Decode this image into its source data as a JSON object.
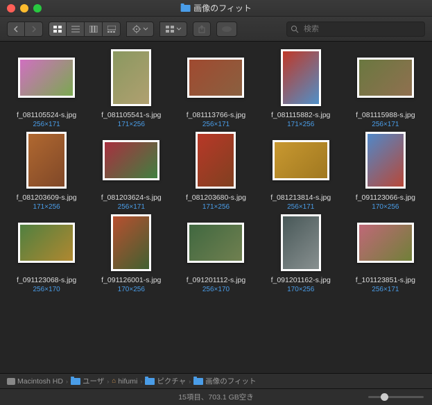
{
  "window": {
    "title": "画像のフィット"
  },
  "colors": {
    "close": "#ff5f57",
    "min": "#febc2e",
    "max": "#28c840",
    "accent": "#4a9de8"
  },
  "search": {
    "placeholder": "検索"
  },
  "path": [
    {
      "icon": "hdd",
      "label": "Macintosh HD"
    },
    {
      "icon": "folder",
      "label": "ユーザ"
    },
    {
      "icon": "home",
      "label": "hifumi"
    },
    {
      "icon": "folder",
      "label": "ピクチャ"
    },
    {
      "icon": "folder",
      "label": "画像のフィット"
    }
  ],
  "status": "15項目、703.1 GB空き",
  "files": [
    {
      "name": "f_081105524-s.jpg",
      "dims": "256×171",
      "orient": "land",
      "hues": [
        "#d070c0",
        "#7aa850"
      ]
    },
    {
      "name": "f_081105541-s.jpg",
      "dims": "171×256",
      "orient": "port",
      "hues": [
        "#8a9860",
        "#b0a070"
      ]
    },
    {
      "name": "f_081113766-s.jpg",
      "dims": "256×171",
      "orient": "land",
      "hues": [
        "#a04a30",
        "#8a6040"
      ]
    },
    {
      "name": "f_081115882-s.jpg",
      "dims": "171×256",
      "orient": "port",
      "hues": [
        "#c03828",
        "#5090c8"
      ]
    },
    {
      "name": "f_081115988-s.jpg",
      "dims": "256×171",
      "orient": "land",
      "hues": [
        "#6a7840",
        "#907050"
      ]
    },
    {
      "name": "f_081203609-s.jpg",
      "dims": "171×256",
      "orient": "port",
      "hues": [
        "#b06830",
        "#804828"
      ]
    },
    {
      "name": "f_081203624-s.jpg",
      "dims": "256×171",
      "orient": "land",
      "hues": [
        "#a83040",
        "#408040"
      ]
    },
    {
      "name": "f_081203680-s.jpg",
      "dims": "171×256",
      "orient": "port",
      "hues": [
        "#b83828",
        "#804020"
      ]
    },
    {
      "name": "f_081213814-s.jpg",
      "dims": "256×171",
      "orient": "land",
      "hues": [
        "#c89830",
        "#a07820"
      ]
    },
    {
      "name": "f_091123066-s.jpg",
      "dims": "170×256",
      "orient": "port",
      "hues": [
        "#5088c8",
        "#b84838"
      ]
    },
    {
      "name": "f_091123068-s.jpg",
      "dims": "256×170",
      "orient": "land",
      "hues": [
        "#508040",
        "#b08830"
      ]
    },
    {
      "name": "f_091126001-s.jpg",
      "dims": "170×256",
      "orient": "port",
      "hues": [
        "#b85030",
        "#406030"
      ]
    },
    {
      "name": "f_091201112-s.jpg",
      "dims": "256×170",
      "orient": "land",
      "hues": [
        "#406840",
        "#708050"
      ]
    },
    {
      "name": "f_091201162-s.jpg",
      "dims": "170×256",
      "orient": "port",
      "hues": [
        "#485858",
        "#889090"
      ]
    },
    {
      "name": "f_101123851-s.jpg",
      "dims": "256×171",
      "orient": "land",
      "hues": [
        "#c06878",
        "#708038"
      ]
    }
  ]
}
